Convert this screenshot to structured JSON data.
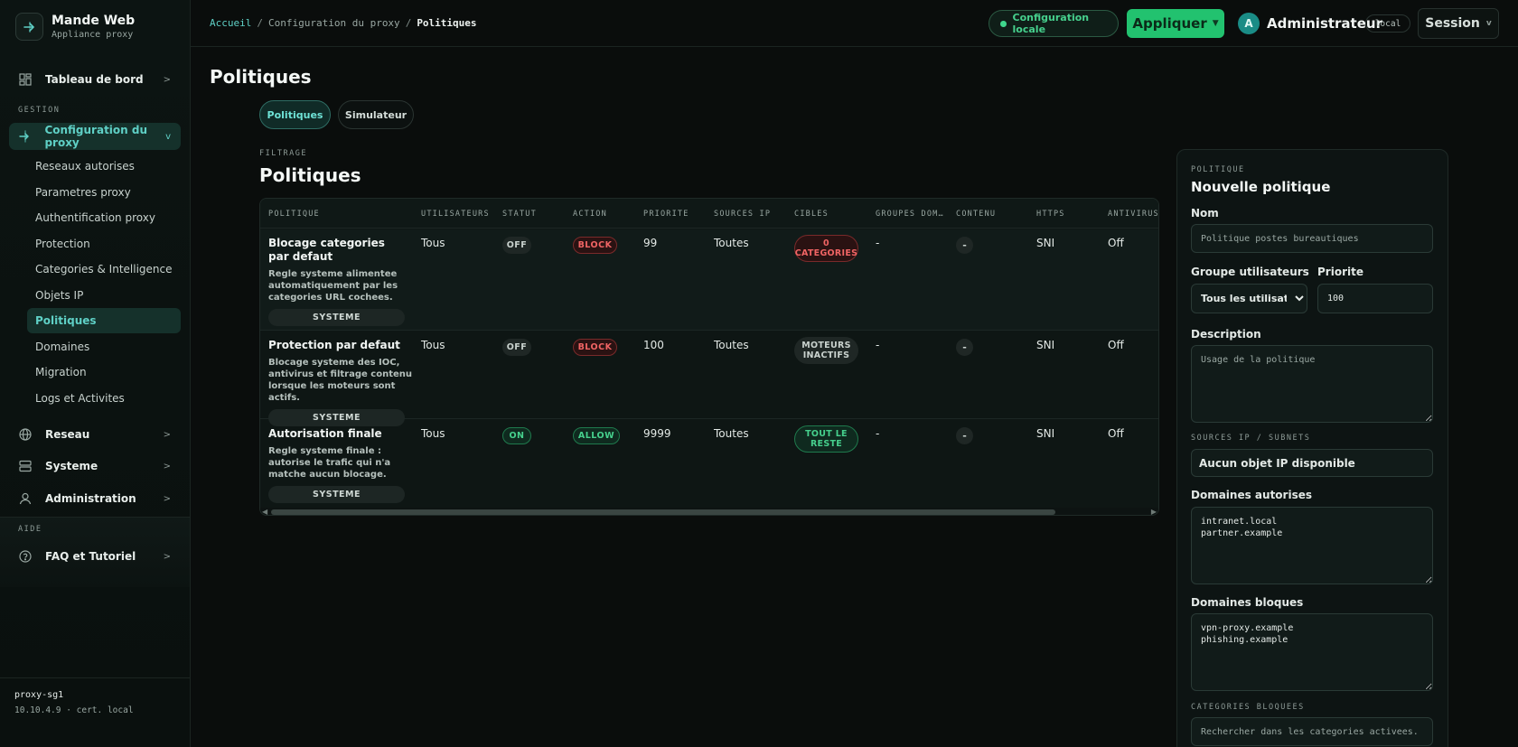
{
  "brand": {
    "title": "Mande Web",
    "subtitle": "Appliance proxy"
  },
  "sidebar": {
    "dashboard": "Tableau de bord",
    "section_gestion": "GESTION",
    "proxy_config": "Configuration du proxy",
    "sub_items": [
      "Reseaux autorises",
      "Parametres proxy",
      "Authentification proxy",
      "Protection",
      "Categories & Intelligence",
      "Objets IP",
      "Politiques",
      "Domaines",
      "Migration",
      "Logs et Activites"
    ],
    "active_sub": "Politiques",
    "network": "Reseau",
    "system": "Systeme",
    "administration": "Administration",
    "section_aide": "AIDE",
    "faq": "FAQ et Tutoriel",
    "footer_host": "proxy-sg1",
    "footer_addr": "10.10.4.9 · cert. local"
  },
  "topbar": {
    "breadcrumb": [
      "Accueil",
      "Configuration du proxy",
      "Politiques"
    ],
    "status": "Configuration locale",
    "apply": "Appliquer",
    "avatar_initial": "A",
    "user": "Administrateur",
    "badge": "local",
    "session": "Session"
  },
  "main": {
    "page_title": "Politiques",
    "tabs": [
      "Politiques",
      "Simulateur"
    ],
    "kicker": "FILTRAGE",
    "section_title": "Politiques",
    "columns": [
      "POLITIQUE",
      "UTILISATEURS",
      "STATUT",
      "ACTION",
      "PRIORITE",
      "SOURCES IP",
      "CIBLES",
      "GROUPES DOM…",
      "CONTENU",
      "HTTPS",
      "ANTIVIRUS"
    ],
    "rows": [
      {
        "name": "Blocage categories par defaut",
        "desc": "Regle systeme alimentee automatiquement par les categories URL cochees.",
        "badge": "SYSTEME",
        "users": "Tous",
        "status": "OFF",
        "action": "BLOCK",
        "priority": "99",
        "sources": "Toutes",
        "targets": "0 CATEGORIES",
        "domain_groups": "-",
        "content": "-",
        "https": "SNI",
        "antivirus": "Off"
      },
      {
        "name": "Protection par defaut",
        "desc": "Blocage systeme des IOC, antivirus et filtrage contenu lorsque les moteurs sont actifs.",
        "badge": "SYSTEME",
        "users": "Tous",
        "status": "OFF",
        "action": "BLOCK",
        "priority": "100",
        "sources": "Toutes",
        "targets": "MOTEURS INACTIFS",
        "domain_groups": "-",
        "content": "-",
        "https": "SNI",
        "antivirus": "Off"
      },
      {
        "name": "Autorisation finale",
        "desc": "Regle systeme finale : autorise le trafic qui n'a matche aucun blocage.",
        "badge": "SYSTEME",
        "users": "Tous",
        "status": "ON",
        "action": "ALLOW",
        "priority": "9999",
        "sources": "Toutes",
        "targets": "TOUT LE RESTE",
        "domain_groups": "-",
        "content": "-",
        "https": "SNI",
        "antivirus": "Off"
      }
    ]
  },
  "panel": {
    "kicker": "POLITIQUE",
    "title": "Nouvelle politique",
    "name_label": "Nom",
    "name_placeholder": "Politique postes bureautiques",
    "group_label": "Groupe utilisateurs",
    "group_value": "Tous les utilisateurs",
    "priority_label": "Priorite",
    "priority_value": "100",
    "description_label": "Description",
    "description_placeholder": "Usage de la politique",
    "sources_label": "SOURCES IP / SUBNETS",
    "sources_empty": "Aucun objet IP disponible",
    "allowed_label": "Domaines autorises",
    "allowed_value": "intranet.local\npartner.example",
    "blocked_label": "Domaines bloques",
    "blocked_value": "vpn-proxy.example\nphishing.example",
    "categories_label": "CATEGORIES BLOQUEES",
    "categories_placeholder": "Rechercher dans les categories activees."
  },
  "colors": {
    "accent": "#5fd0c6",
    "success": "#22c26f",
    "danger": "#f06464",
    "background": "#0a0d0c"
  }
}
